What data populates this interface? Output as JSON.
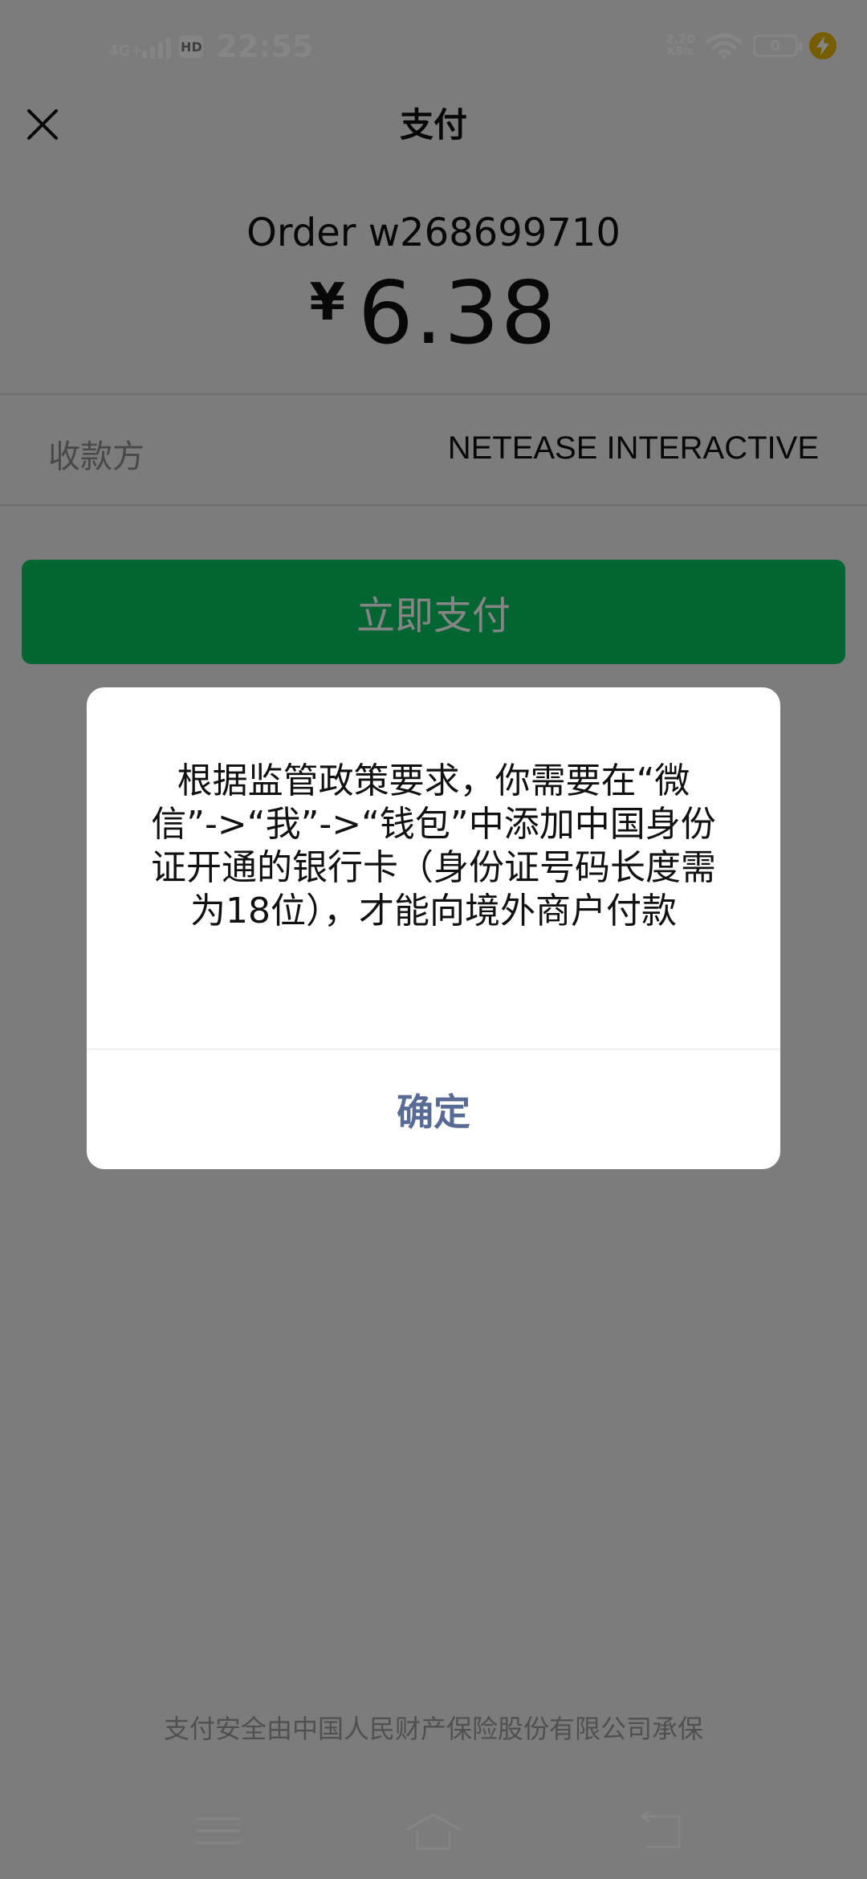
{
  "status_bar": {
    "network": "4G+",
    "hd_badge": "HD",
    "time": "22:55",
    "speed_value": "2.20",
    "speed_unit": "KB/s",
    "battery_level": "0"
  },
  "header": {
    "title": "支付",
    "close_icon": "close-icon"
  },
  "payment": {
    "order_label": "Order w268699710",
    "currency": "¥",
    "amount": "6.38",
    "payee_label": "收款方",
    "payee_value": "NETEASE INTERACTIVE",
    "pay_button_label": "立即支付"
  },
  "dialog": {
    "message": "根据监管政策要求，你需要在“微信”->“我”->“钱包”中添加中国身份证开通的银行卡（身份证号码长度需为18位），才能向境外商户付款",
    "confirm_label": "确定"
  },
  "footer": {
    "insurance_note": "支付安全由中国人民财产保险股份有限公司承保"
  },
  "colors": {
    "accent_green": "#07c160",
    "dialog_link": "#576b95",
    "background": "#ededed"
  }
}
